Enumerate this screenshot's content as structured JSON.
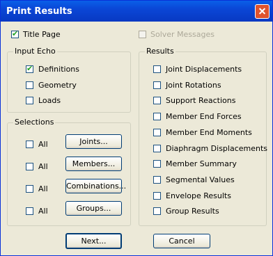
{
  "window": {
    "title": "Print Results"
  },
  "title_page": {
    "label": "Title Page",
    "checked": true
  },
  "solver_messages": {
    "label": "Solver Messages",
    "checked": false,
    "disabled": true
  },
  "input_echo": {
    "title": "Input Echo",
    "items": [
      {
        "label": "Definitions",
        "checked": true
      },
      {
        "label": "Geometry",
        "checked": false
      },
      {
        "label": "Loads",
        "checked": false
      }
    ]
  },
  "selections": {
    "title": "Selections",
    "rows": [
      {
        "all_label": "All",
        "button": "Joints..."
      },
      {
        "all_label": "All",
        "button": "Members..."
      },
      {
        "all_label": "All",
        "button": "Combinations..."
      },
      {
        "all_label": "All",
        "button": "Groups..."
      }
    ]
  },
  "results": {
    "title": "Results",
    "items": [
      {
        "label": "Joint Displacements",
        "checked": false
      },
      {
        "label": "Joint Rotations",
        "checked": false
      },
      {
        "label": "Support Reactions",
        "checked": false
      },
      {
        "label": "Member End Forces",
        "checked": false
      },
      {
        "label": "Member End Moments",
        "checked": false
      },
      {
        "label": "Diaphragm Displacements",
        "checked": false
      },
      {
        "label": "Member Summary",
        "checked": false
      },
      {
        "label": "Segmental Values",
        "checked": false
      },
      {
        "label": "Envelope Results",
        "checked": false
      },
      {
        "label": "Group Results",
        "checked": false
      }
    ]
  },
  "footer": {
    "next_label": "Next...",
    "cancel_label": "Cancel"
  }
}
